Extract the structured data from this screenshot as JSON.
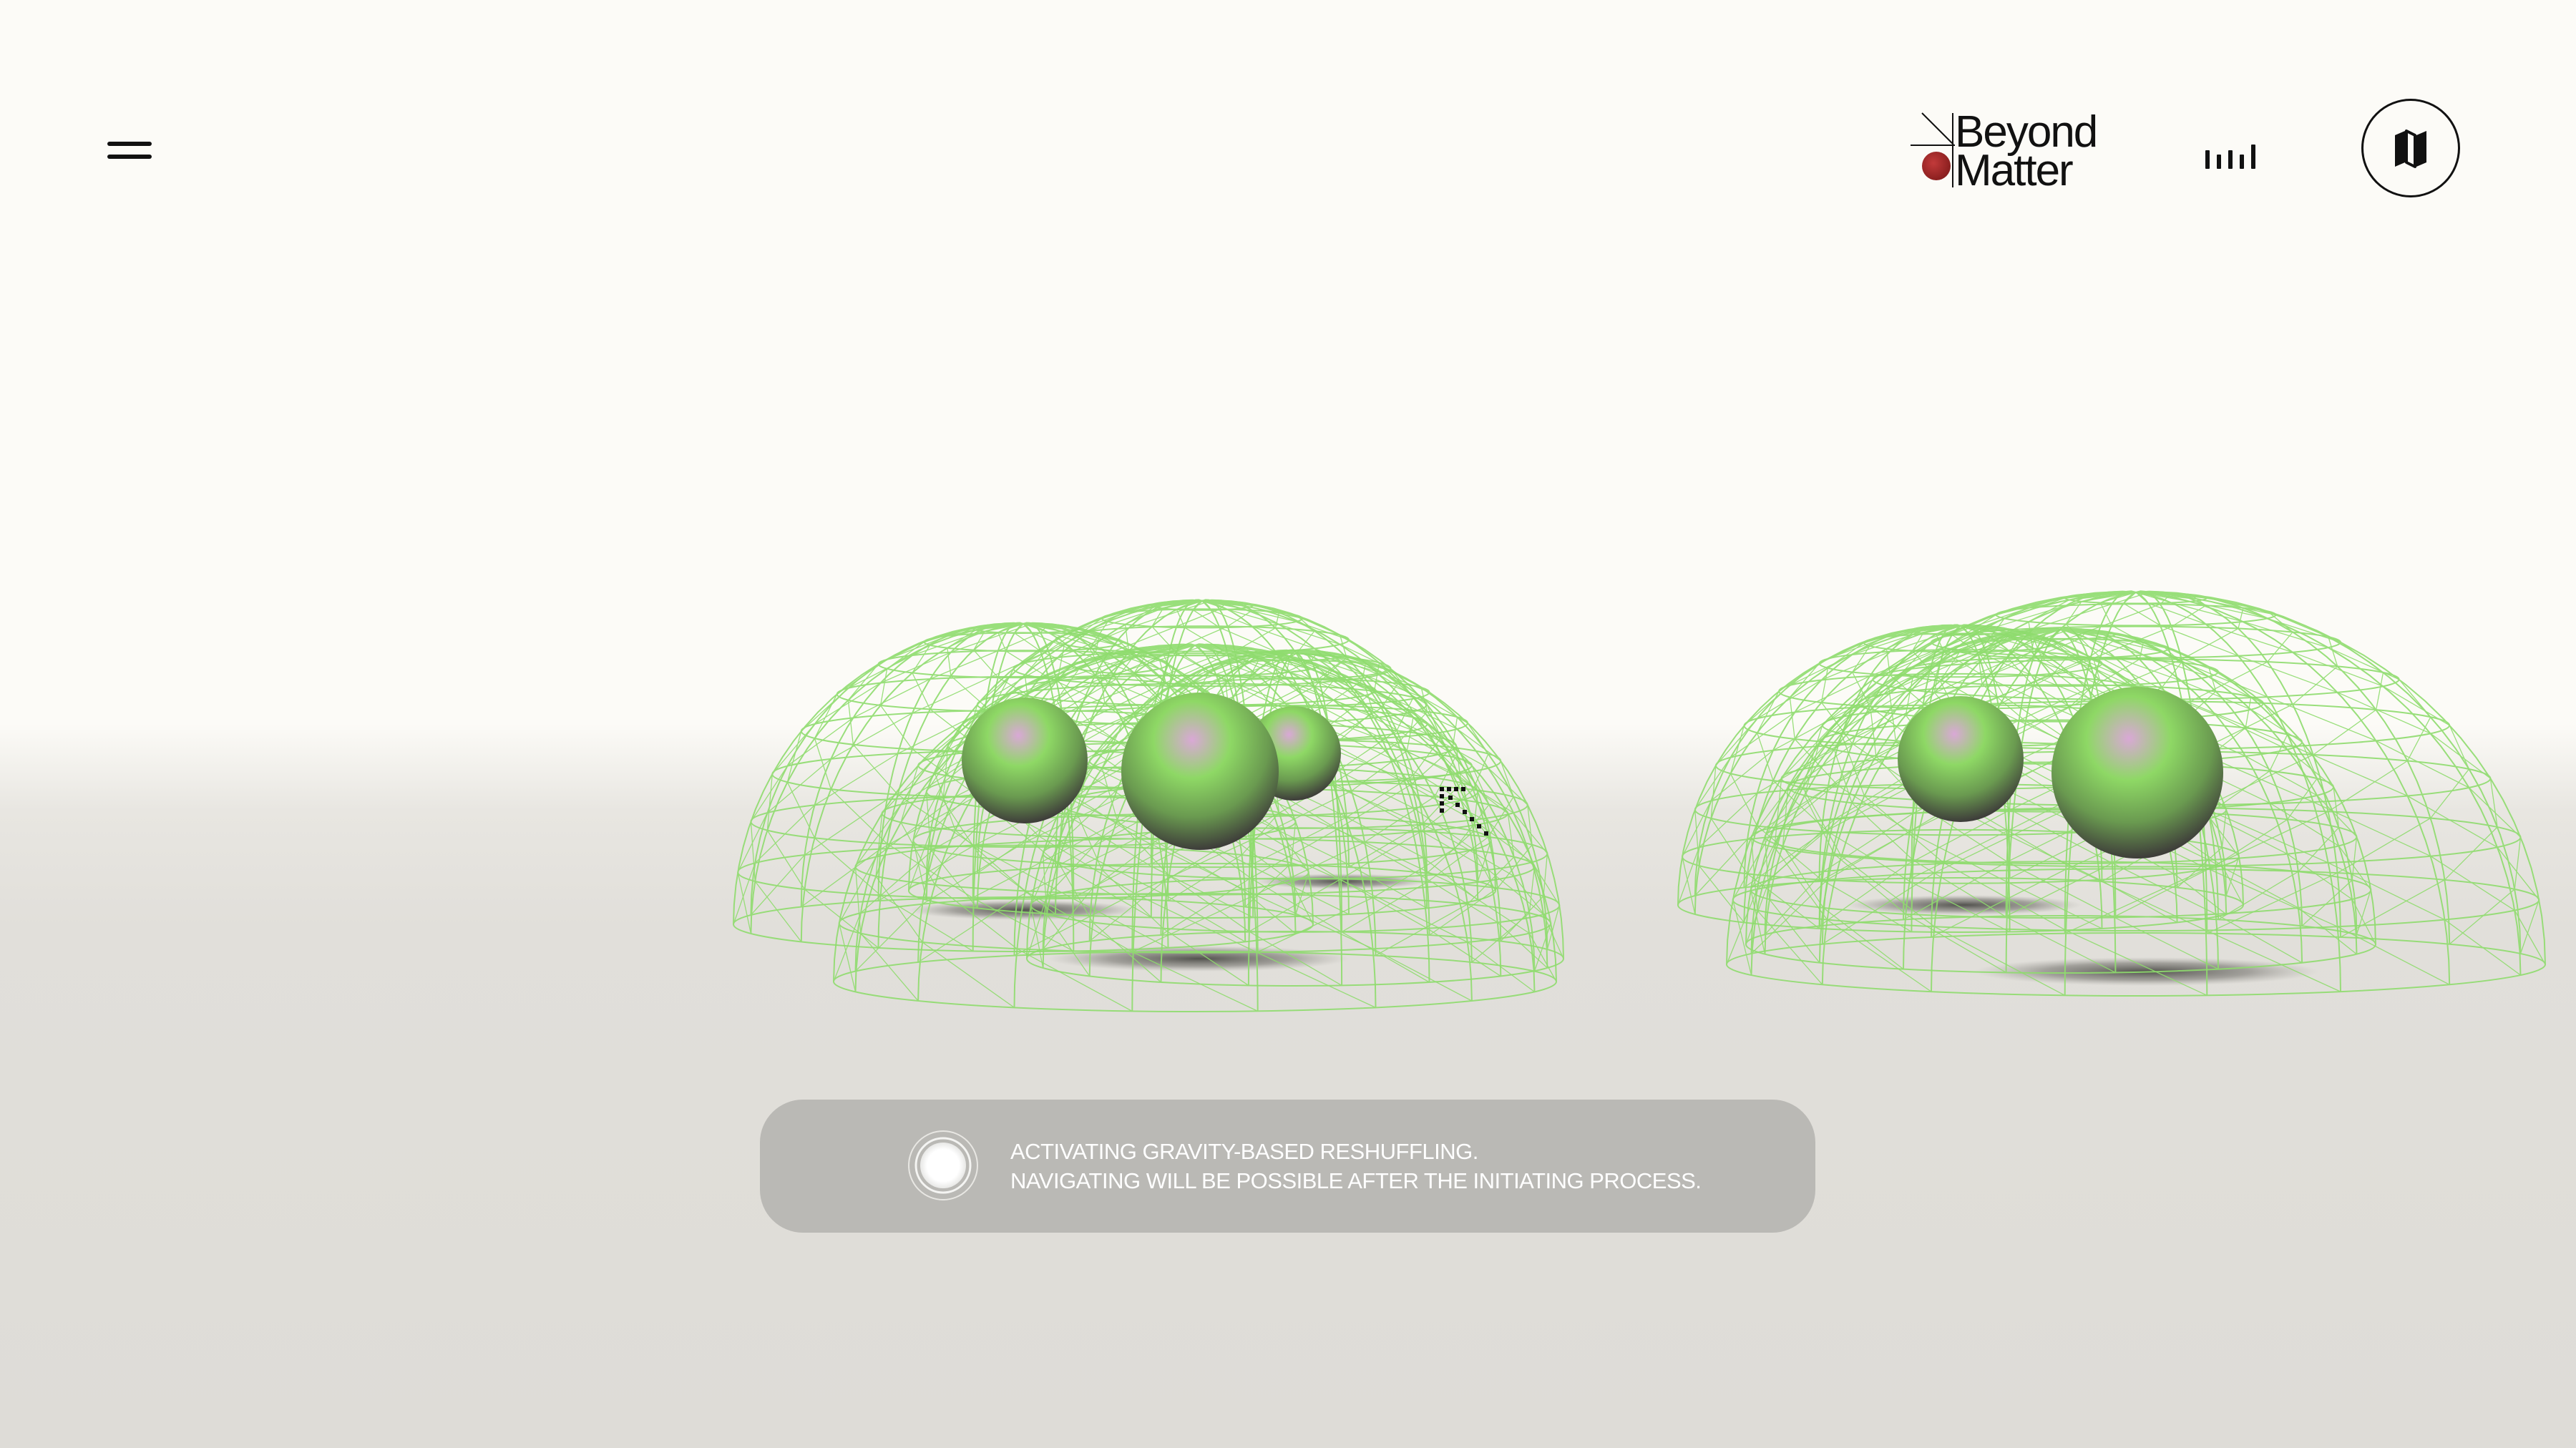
{
  "brand": {
    "line1": "Beyond",
    "line2": "Matter",
    "dot_color": "#a62a2a"
  },
  "header": {
    "menu_icon": "hamburger-icon",
    "sound_icon": "sound-bars-icon",
    "map_icon": "map-icon"
  },
  "scene": {
    "wireframe_color": "#8fdc6e",
    "sphere_color": "#7fd45c",
    "cursor_icon": "arrow-up-left-icon"
  },
  "status": {
    "line1": "ACTIVATING GRAVITY-BASED RESHUFFLING.",
    "line2": "NAVIGATING WILL BE POSSIBLE AFTER THE INITIATING PROCESS.",
    "loader_icon": "loading-ring-icon"
  }
}
